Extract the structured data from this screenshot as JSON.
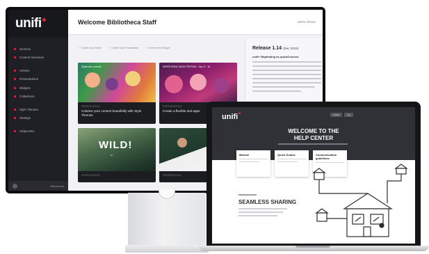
{
  "desktop": {
    "logo": "unifi",
    "sidebar": {
      "items": [
        {
          "label": "Screens"
        },
        {
          "label": "Content Overview"
        },
        {
          "label": "Articles"
        },
        {
          "label": "Presentations"
        },
        {
          "label": "Widgets"
        },
        {
          "label": "Collections"
        },
        {
          "label": "Style Themes"
        },
        {
          "label": "Settings"
        },
        {
          "label": "Helpcenter"
        }
      ],
      "footer_label": "Bibliotheca"
    },
    "header": {
      "title": "Welcome Bibliotheca Staff",
      "user": "US/AU Showc"
    },
    "actions": [
      {
        "label": "Create new Article"
      },
      {
        "label": "Create new Presentation"
      },
      {
        "label": "Create new Widget"
      }
    ],
    "cards": [
      {
        "tag": "September concerts",
        "category": "PRESENTATION",
        "title": "Colorize your content beautifully with Style Themes"
      },
      {
        "tag": "SUPER SONIC MUSIC FESTIVAL · Sep 17 - 18",
        "category": "PRESENTATION",
        "title": "Create a flexible and appe"
      },
      {
        "overlay": "WILD!",
        "category": "PRESENTATION",
        "title": ""
      },
      {
        "overlay": "V",
        "category": "PRESENTATION",
        "title": ""
      }
    ],
    "release": {
      "title": "Release 1.14",
      "date": "(Dec 2024)",
      "subtitle": "unifi+ Wayfinding as quickConnect"
    }
  },
  "laptop": {
    "logo": "unifi",
    "nav_buttons": [
      "English",
      "Log"
    ],
    "hero_title_line1": "WELCOME TO THE",
    "hero_title_line2": "HELP CENTER",
    "cards": [
      {
        "title": "Manual"
      },
      {
        "title": "Quick Guides"
      },
      {
        "title": "Communication guidelines"
      }
    ],
    "section_title": "SEAMLESS SHARING"
  },
  "colors": {
    "accent": "#e0242f",
    "sidebar_bg": "#1f2025",
    "hero_bg": "#2f3136"
  }
}
